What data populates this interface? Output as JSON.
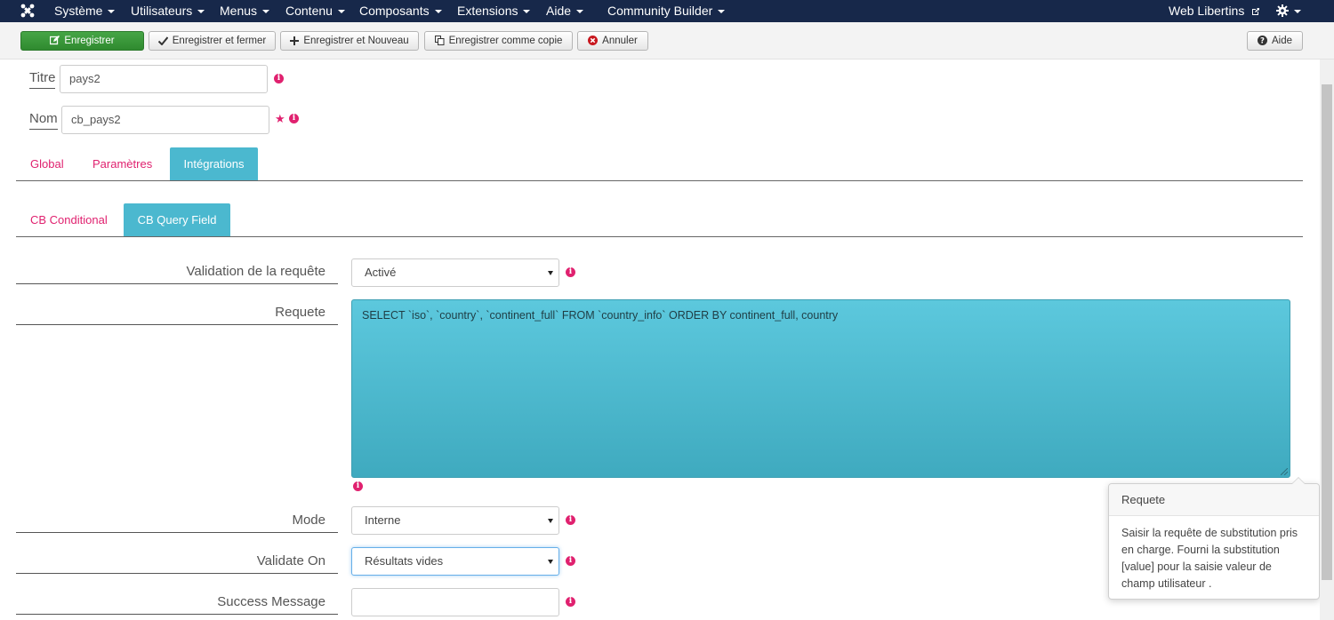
{
  "nav": {
    "items": [
      {
        "label": "Système"
      },
      {
        "label": "Utilisateurs"
      },
      {
        "label": "Menus"
      },
      {
        "label": "Contenu"
      },
      {
        "label": "Composants"
      },
      {
        "label": "Extensions"
      },
      {
        "label": "Aide"
      },
      {
        "label": "Community Builder"
      }
    ],
    "site_label": "Web Libertins"
  },
  "toolbar": {
    "save": "Enregistrer",
    "save_close": "Enregistrer et fermer",
    "save_new": "Enregistrer et Nouveau",
    "save_copy": "Enregistrer comme copie",
    "cancel": "Annuler",
    "help": "Aide"
  },
  "form": {
    "title_label": "Titre",
    "title_value": "pays2",
    "name_label": "Nom",
    "name_value": "cb_pays2"
  },
  "tabs": {
    "main": [
      "Global",
      "Paramètres",
      "Intégrations"
    ],
    "active_main": "Intégrations",
    "sub": [
      "CB Conditional",
      "CB Query Field"
    ],
    "active_sub": "CB Query Field"
  },
  "fields": {
    "validation_label": "Validation de la requête",
    "validation_value": "Activé",
    "query_label": "Requete",
    "query_value": "SELECT `iso`, `country`, `continent_full` FROM `country_info`  ORDER BY  continent_full, country",
    "mode_label": "Mode",
    "mode_value": "Interne",
    "validate_on_label": "Validate On",
    "validate_on_value": "Résultats vides",
    "success_label": "Success Message",
    "success_value": ""
  },
  "popover": {
    "title": "Requete",
    "body": "Saisir la requête de substitution pris en charge. Fourni la substitution [value] pour la saisie valeur de champ utilisateur ."
  },
  "colors": {
    "nav_bg": "#17284a",
    "accent": "#e0216f",
    "tab_active": "#4bb8cf",
    "save_green": "#3c9b3c"
  },
  "icons": {
    "logo": "joomla-logo",
    "save": "edit-icon",
    "save_close": "check-icon",
    "save_new": "plus-icon",
    "save_copy": "copy-icon",
    "cancel": "cancel-circle-icon",
    "help": "question-circle-icon",
    "settings": "gear-icon",
    "external": "external-link-icon",
    "info": "info-icon",
    "required": "star-icon"
  }
}
